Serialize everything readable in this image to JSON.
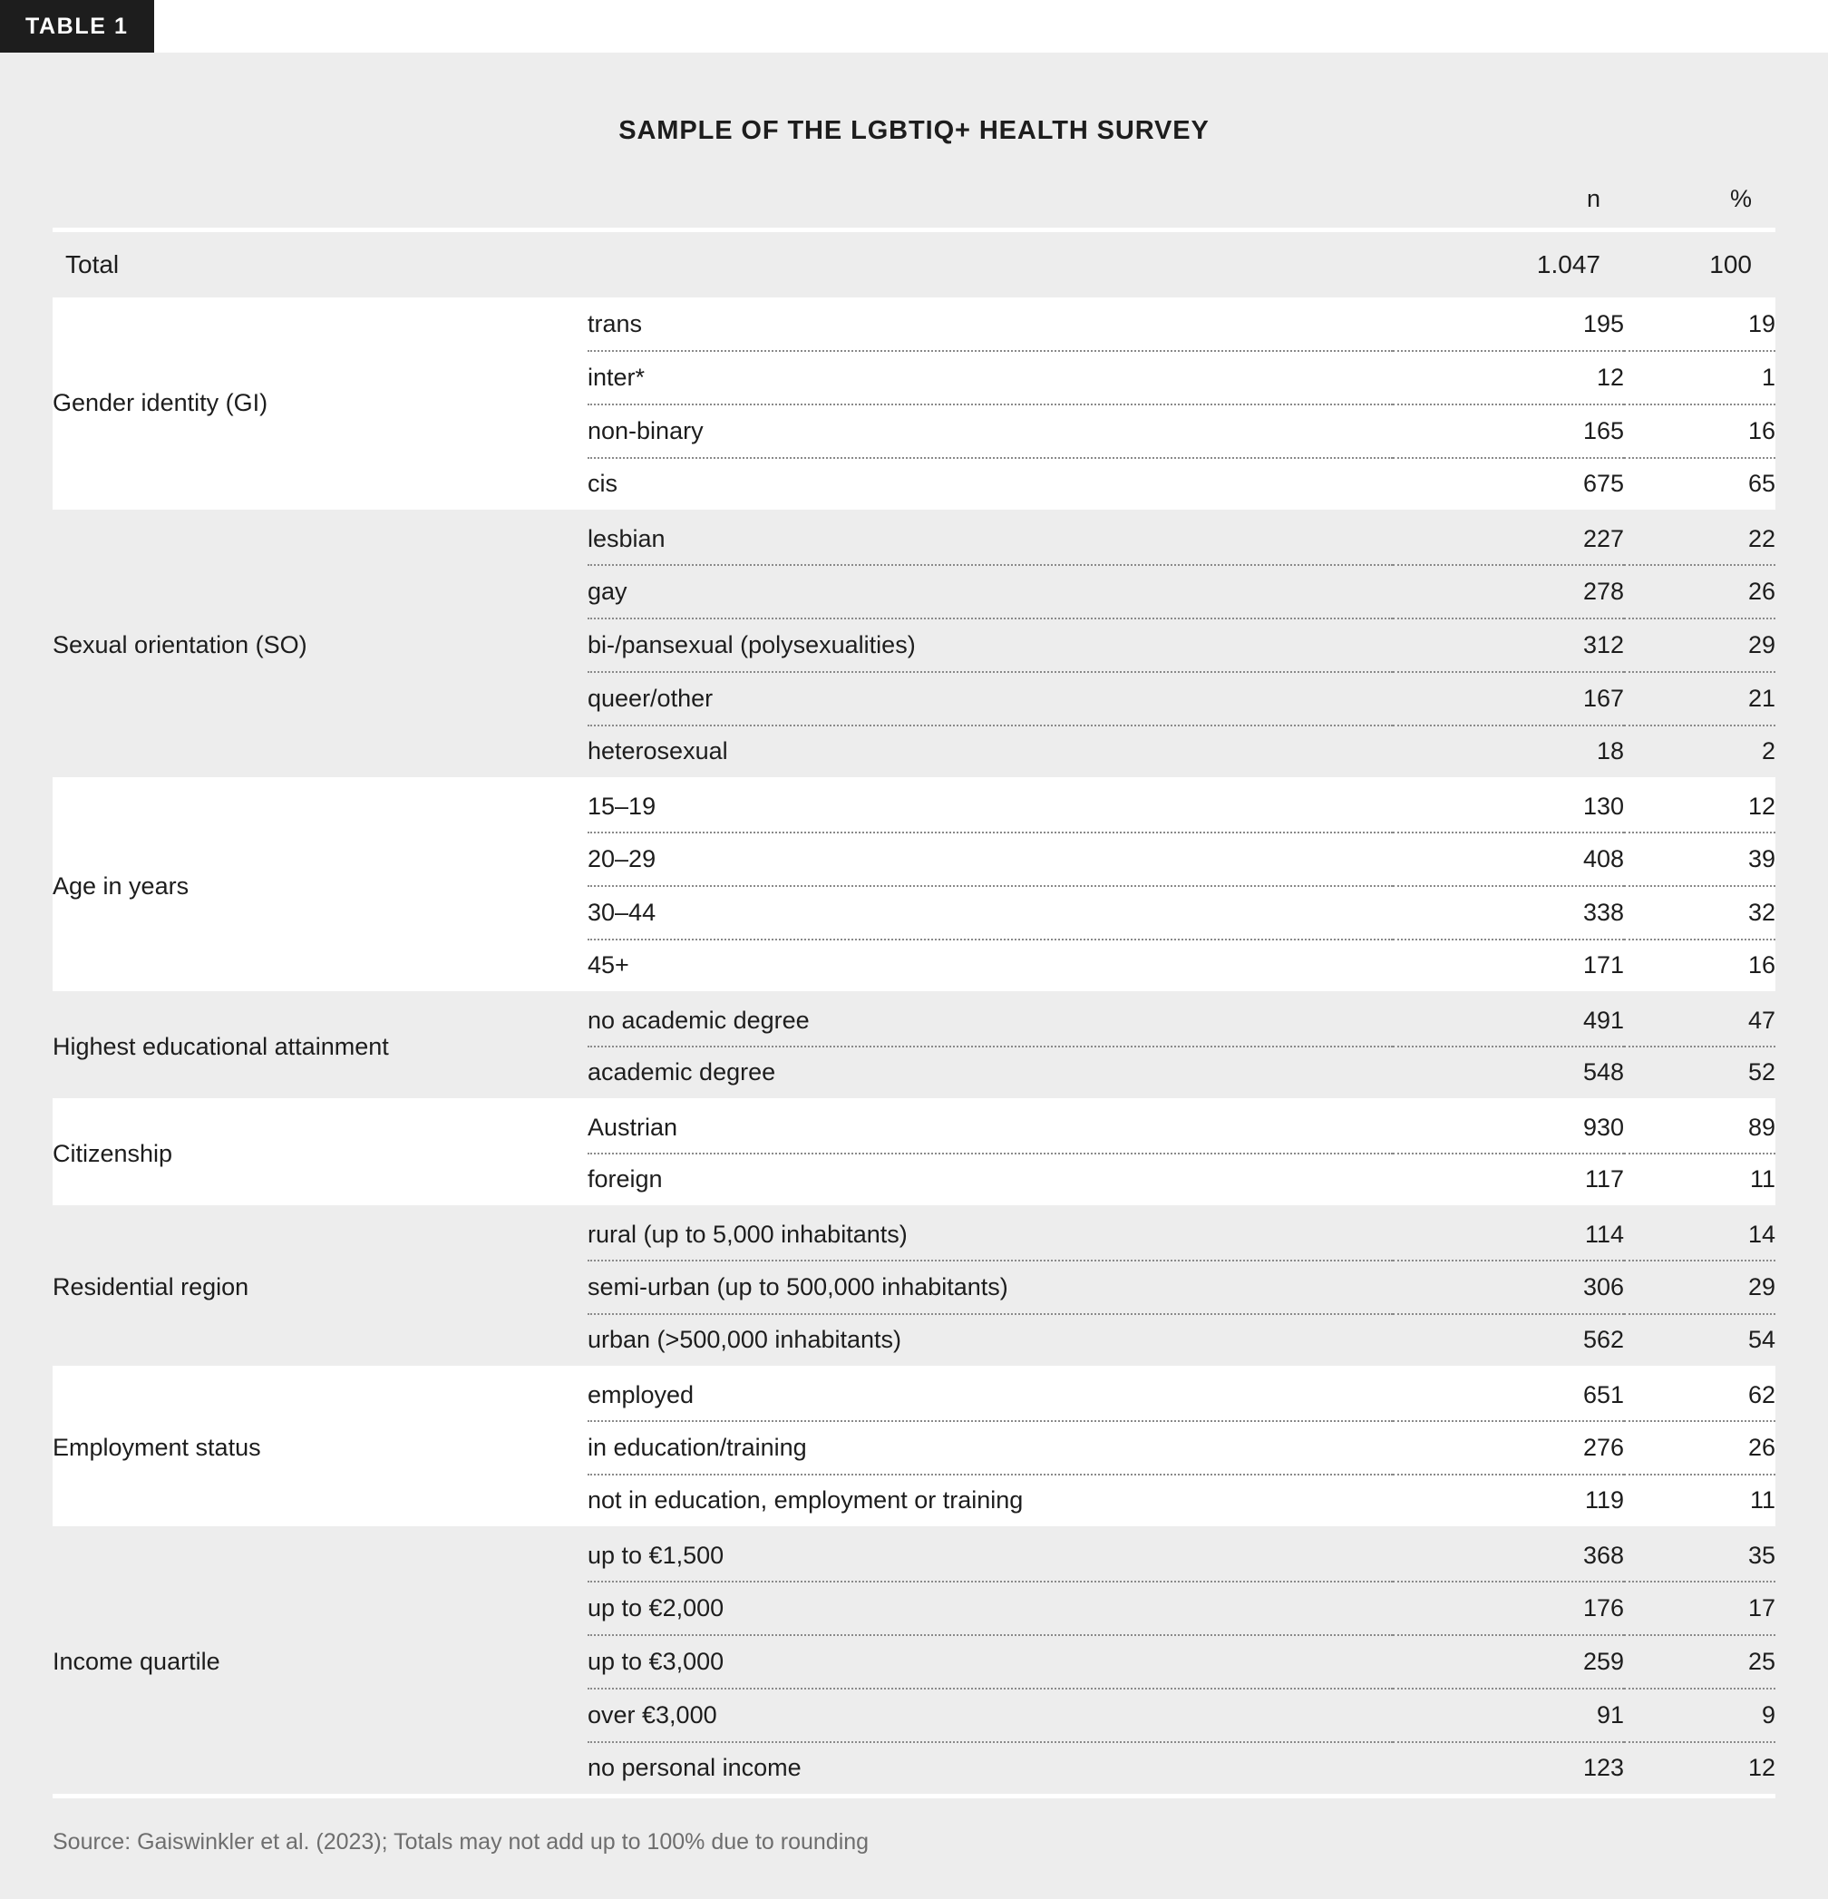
{
  "badge": {
    "label": "TABLE 1"
  },
  "title": "SAMPLE OF THE LGBTIQ+ HEALTH SURVEY",
  "columns": {
    "category": "",
    "label": "",
    "n": "n",
    "pct": "%"
  },
  "total": {
    "label": "Total",
    "n": "1.047",
    "pct": "100"
  },
  "source": "Source: Gaiswinkler et al. (2023); Totals may not add up to 100% due to rounding",
  "colors": {
    "page_background": "#ededed",
    "band_white": "#ffffff",
    "band_gray": "#ededed",
    "badge_background": "#1d1d1d",
    "badge_text": "#ffffff",
    "text": "#1d1d1d",
    "source_text": "#6e6e6e",
    "separator_dotted": "#8a8a8a"
  },
  "sections": [
    {
      "category": "Gender identity (GI)",
      "band": "white",
      "rows": [
        {
          "label": "trans",
          "n": "195",
          "pct": "19"
        },
        {
          "label": "inter*",
          "n": "12",
          "pct": "1"
        },
        {
          "label": "non-binary",
          "n": "165",
          "pct": "16"
        },
        {
          "label": "cis",
          "n": "675",
          "pct": "65"
        }
      ]
    },
    {
      "category": "Sexual orientation (SO)",
      "band": "gray",
      "rows": [
        {
          "label": "lesbian",
          "n": "227",
          "pct": "22"
        },
        {
          "label": "gay",
          "n": "278",
          "pct": "26"
        },
        {
          "label": "bi-/pansexual (polysexualities)",
          "n": "312",
          "pct": "29"
        },
        {
          "label": "queer/other",
          "n": "167",
          "pct": "21"
        },
        {
          "label": "heterosexual",
          "n": "18",
          "pct": "2"
        }
      ]
    },
    {
      "category": "Age in years",
      "band": "white",
      "rows": [
        {
          "label": "15–19",
          "n": "130",
          "pct": "12"
        },
        {
          "label": "20–29",
          "n": "408",
          "pct": "39"
        },
        {
          "label": "30–44",
          "n": "338",
          "pct": "32"
        },
        {
          "label": "45+",
          "n": "171",
          "pct": "16"
        }
      ]
    },
    {
      "category": "Highest educational attainment",
      "band": "gray",
      "rows": [
        {
          "label": "no academic degree",
          "n": "491",
          "pct": "47"
        },
        {
          "label": "academic degree",
          "n": "548",
          "pct": "52"
        }
      ]
    },
    {
      "category": "Citizenship",
      "band": "white",
      "rows": [
        {
          "label": "Austrian",
          "n": "930",
          "pct": "89"
        },
        {
          "label": "foreign",
          "n": "117",
          "pct": "11"
        }
      ]
    },
    {
      "category": "Residential region",
      "band": "gray",
      "rows": [
        {
          "label": "rural (up to 5,000 inhabitants)",
          "n": "114",
          "pct": "14"
        },
        {
          "label": "semi-urban (up to 500,000 inhabitants)",
          "n": "306",
          "pct": "29"
        },
        {
          "label": "urban (>500,000 inhabitants)",
          "n": "562",
          "pct": "54"
        }
      ]
    },
    {
      "category": "Employment status",
      "band": "white",
      "rows": [
        {
          "label": "employed",
          "n": "651",
          "pct": "62"
        },
        {
          "label": "in education/training",
          "n": "276",
          "pct": "26"
        },
        {
          "label": "not in education, employment or training",
          "n": "119",
          "pct": "11"
        }
      ]
    },
    {
      "category": "Income quartile",
      "band": "gray",
      "rows": [
        {
          "label": "up to €1,500",
          "n": "368",
          "pct": "35"
        },
        {
          "label": "up to €2,000",
          "n": "176",
          "pct": "17"
        },
        {
          "label": "up to €3,000",
          "n": "259",
          "pct": "25"
        },
        {
          "label": "over €3,000",
          "n": "91",
          "pct": "9"
        },
        {
          "label": "no personal income",
          "n": "123",
          "pct": "12"
        }
      ]
    }
  ]
}
